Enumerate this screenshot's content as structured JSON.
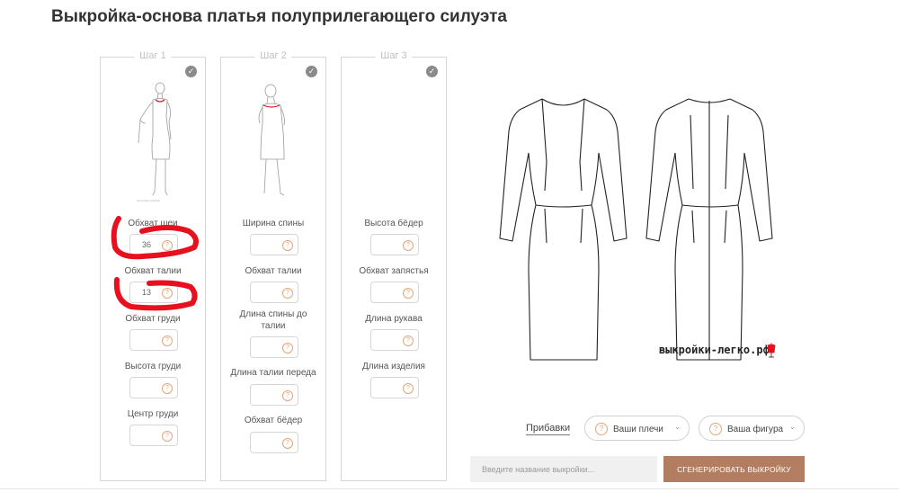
{
  "page": {
    "title": "Выкройка-основа платья полуприлегающего силуэта"
  },
  "steps": [
    {
      "label": "Шаг 1",
      "fields": [
        {
          "label": "Обхват шеи",
          "value": "36"
        },
        {
          "label": "Обхват талии",
          "value": "13"
        },
        {
          "label": "Обхват груди",
          "value": ""
        },
        {
          "label": "Высота груди",
          "value": ""
        },
        {
          "label": "Центр груди",
          "value": ""
        }
      ]
    },
    {
      "label": "Шаг 2",
      "fields": [
        {
          "label": "Ширина спины",
          "value": ""
        },
        {
          "label": "Обхват талии",
          "value": ""
        },
        {
          "label": "Длина спины до талии",
          "value": ""
        },
        {
          "label": "Длина талии переда",
          "value": ""
        },
        {
          "label": "Обхват бёдер",
          "value": ""
        }
      ]
    },
    {
      "label": "Шаг 3",
      "fields": [
        {
          "label": "Высота бёдер",
          "value": ""
        },
        {
          "label": "Обхват запястья",
          "value": ""
        },
        {
          "label": "Длина рукава",
          "value": ""
        },
        {
          "label": "Длина изделия",
          "value": ""
        }
      ]
    }
  ],
  "preview": {
    "watermark": "выкройки-легко.рф"
  },
  "options": {
    "allowances_label": "Прибавки",
    "shoulders_label": "Ваши плечи",
    "figure_label": "Ваша фигура"
  },
  "footer": {
    "name_placeholder": "Введите название выкройки...",
    "generate_label": "СГЕНЕРИРОВАТЬ ВЫКРОЙКУ"
  },
  "colors": {
    "accent": "#b27d61",
    "help_icon": "#e4a57a",
    "annotation": "#e8101e"
  },
  "icons": {
    "step_done": "check-circle-icon",
    "help": "question-circle-icon",
    "dropdown": "chevron-down-icon"
  }
}
